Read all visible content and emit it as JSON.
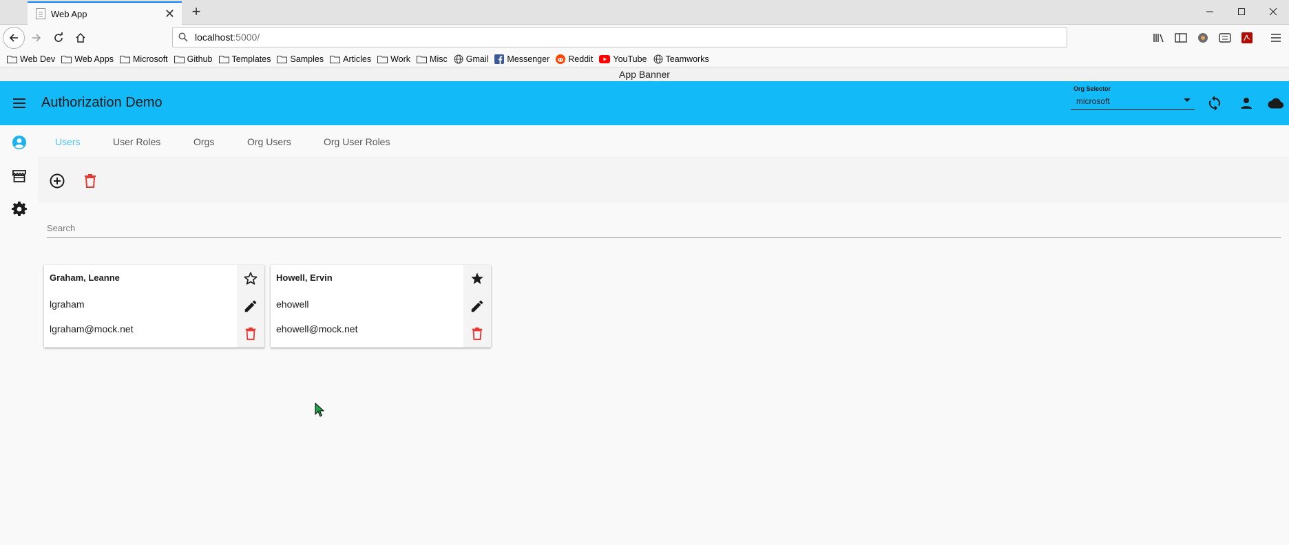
{
  "browser": {
    "tab_title": "Web App",
    "url_host": "localhost",
    "url_path": ":5000/",
    "bookmarks": [
      {
        "label": "Web Dev",
        "icon": "folder-icon"
      },
      {
        "label": "Web Apps",
        "icon": "folder-icon"
      },
      {
        "label": "Microsoft",
        "icon": "folder-icon"
      },
      {
        "label": "Github",
        "icon": "folder-icon"
      },
      {
        "label": "Templates",
        "icon": "folder-icon"
      },
      {
        "label": "Samples",
        "icon": "folder-icon"
      },
      {
        "label": "Articles",
        "icon": "folder-icon"
      },
      {
        "label": "Work",
        "icon": "folder-icon"
      },
      {
        "label": "Misc",
        "icon": "folder-icon"
      },
      {
        "label": "Gmail",
        "icon": "globe-icon"
      },
      {
        "label": "Messenger",
        "icon": "facebook-icon"
      },
      {
        "label": "Reddit",
        "icon": "reddit-icon"
      },
      {
        "label": "YouTube",
        "icon": "youtube-icon"
      },
      {
        "label": "Teamworks",
        "icon": "globe-icon"
      }
    ]
  },
  "app": {
    "banner": "App Banner",
    "title": "Authorization Demo",
    "org_selector": {
      "label": "Org Selector",
      "value": "microsoft"
    },
    "tabs": [
      "Users",
      "User Roles",
      "Orgs",
      "Org Users",
      "Org User Roles"
    ],
    "active_tab": "Users",
    "search_placeholder": "Search",
    "users": [
      {
        "name": "Graham, Leanne",
        "username": "lgraham",
        "email": "lgraham@mock.net",
        "favorite": false
      },
      {
        "name": "Howell, Ervin",
        "username": "ehowell",
        "email": "ehowell@mock.net",
        "favorite": true
      }
    ]
  },
  "colors": {
    "appbar": "#12baf7",
    "active_tab": "#4fc3f7",
    "delete": "#e53935",
    "tab_accent": "#0a84ff"
  }
}
